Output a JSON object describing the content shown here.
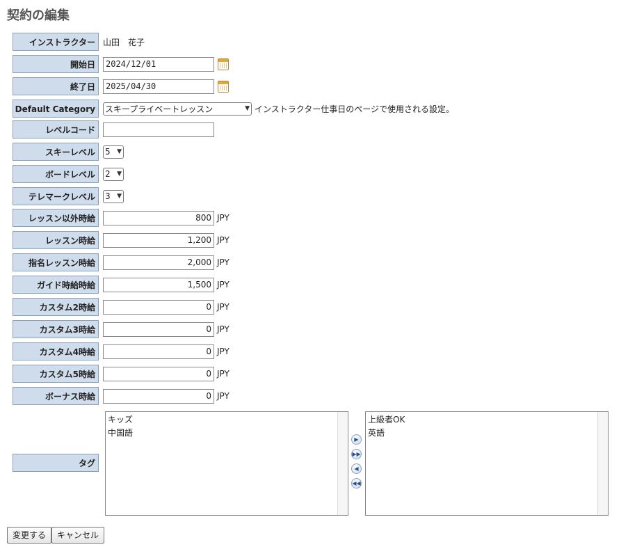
{
  "page": {
    "title": "契約の編集"
  },
  "instructor": {
    "label": "インストラクター",
    "value": "山田　花子"
  },
  "start_date": {
    "label": "開始日",
    "value": "2024/12/01"
  },
  "end_date": {
    "label": "終了日",
    "value": "2025/04/30"
  },
  "default_category": {
    "label": "Default Category",
    "selected": "スキープライベートレッスン",
    "note": "インストラクター仕事日のページで使用される設定。"
  },
  "level_code": {
    "label": "レベルコード",
    "value": ""
  },
  "ski_level": {
    "label": "スキーレベル",
    "selected": "5"
  },
  "board_level": {
    "label": "ボードレベル",
    "selected": "2"
  },
  "telemark_level": {
    "label": "テレマークレベル",
    "selected": "3"
  },
  "rates": [
    {
      "label": "レッスン以外時給",
      "value": "800",
      "unit": "JPY"
    },
    {
      "label": "レッスン時給",
      "value": "1,200",
      "unit": "JPY"
    },
    {
      "label": "指名レッスン時給",
      "value": "2,000",
      "unit": "JPY"
    },
    {
      "label": "ガイド時給時給",
      "value": "1,500",
      "unit": "JPY"
    },
    {
      "label": "カスタム2時給",
      "value": "0",
      "unit": "JPY"
    },
    {
      "label": "カスタム3時給",
      "value": "0",
      "unit": "JPY"
    },
    {
      "label": "カスタム4時給",
      "value": "0",
      "unit": "JPY"
    },
    {
      "label": "カスタム5時給",
      "value": "0",
      "unit": "JPY"
    },
    {
      "label": "ボーナス時給",
      "value": "0",
      "unit": "JPY"
    }
  ],
  "tags": {
    "label": "タグ",
    "available": [
      "キッズ",
      "中国語"
    ],
    "selected": [
      "上級者OK",
      "英語"
    ]
  },
  "buttons": {
    "submit": "変更する",
    "cancel": "キャンセル"
  },
  "icons": {
    "calendar": "calendar-icon",
    "move_right": "arrow-right-icon",
    "move_all_right": "double-arrow-right-icon",
    "move_left": "arrow-left-icon",
    "move_all_left": "double-arrow-left-icon"
  }
}
